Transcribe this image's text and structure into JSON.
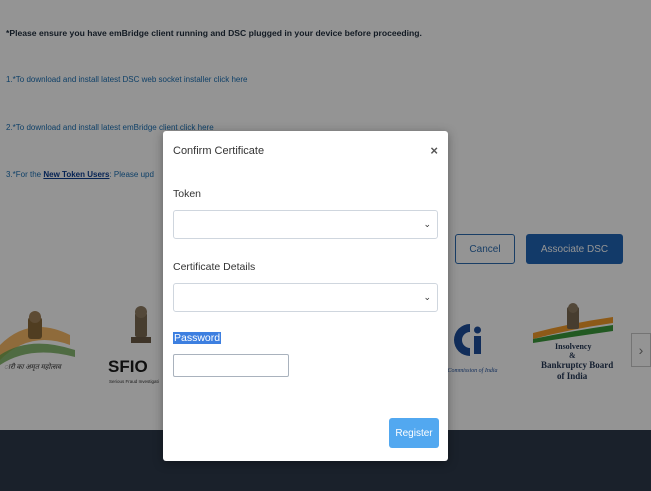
{
  "instructions": {
    "notice": "*Please ensure you have emBridge client running and DSC plugged in your device before proceeding.",
    "line1": "1.*To download and install latest DSC web socket installer click here",
    "line2": "2.*To download and install latest emBridge client click here",
    "line3_prefix": "3.*For the ",
    "line3_link": "New Token Users",
    "line3_suffix": ": Please upd"
  },
  "actions": {
    "cancel_label": "Cancel",
    "associate_label": "Associate DSC"
  },
  "logos": {
    "left_partial_text": "ारी का अमृत महोत्सव",
    "sfio_title": "SFIO",
    "sfio_sub": "Serious Fraud Investigati",
    "cci_text": "n Commission of India",
    "ibbi_line1": "Insolvency",
    "ibbi_line2": "&",
    "ibbi_line3": "Bankruptcy Board",
    "ibbi_line4": "of India"
  },
  "carousel": {
    "next_glyph": "›"
  },
  "modal": {
    "title": "Confirm Certificate",
    "close_glyph": "×",
    "token_label": "Token",
    "token_value": "",
    "cert_label": "Certificate Details",
    "cert_value": "",
    "chevron_glyph": "⌄",
    "password_label": "Password",
    "password_value": "",
    "register_label": "Register"
  },
  "colors": {
    "primary": "#1f64b5",
    "register": "#52a8f0",
    "footer": "#2e3a4a",
    "overlay": "rgba(0,0,0,0.42)"
  }
}
